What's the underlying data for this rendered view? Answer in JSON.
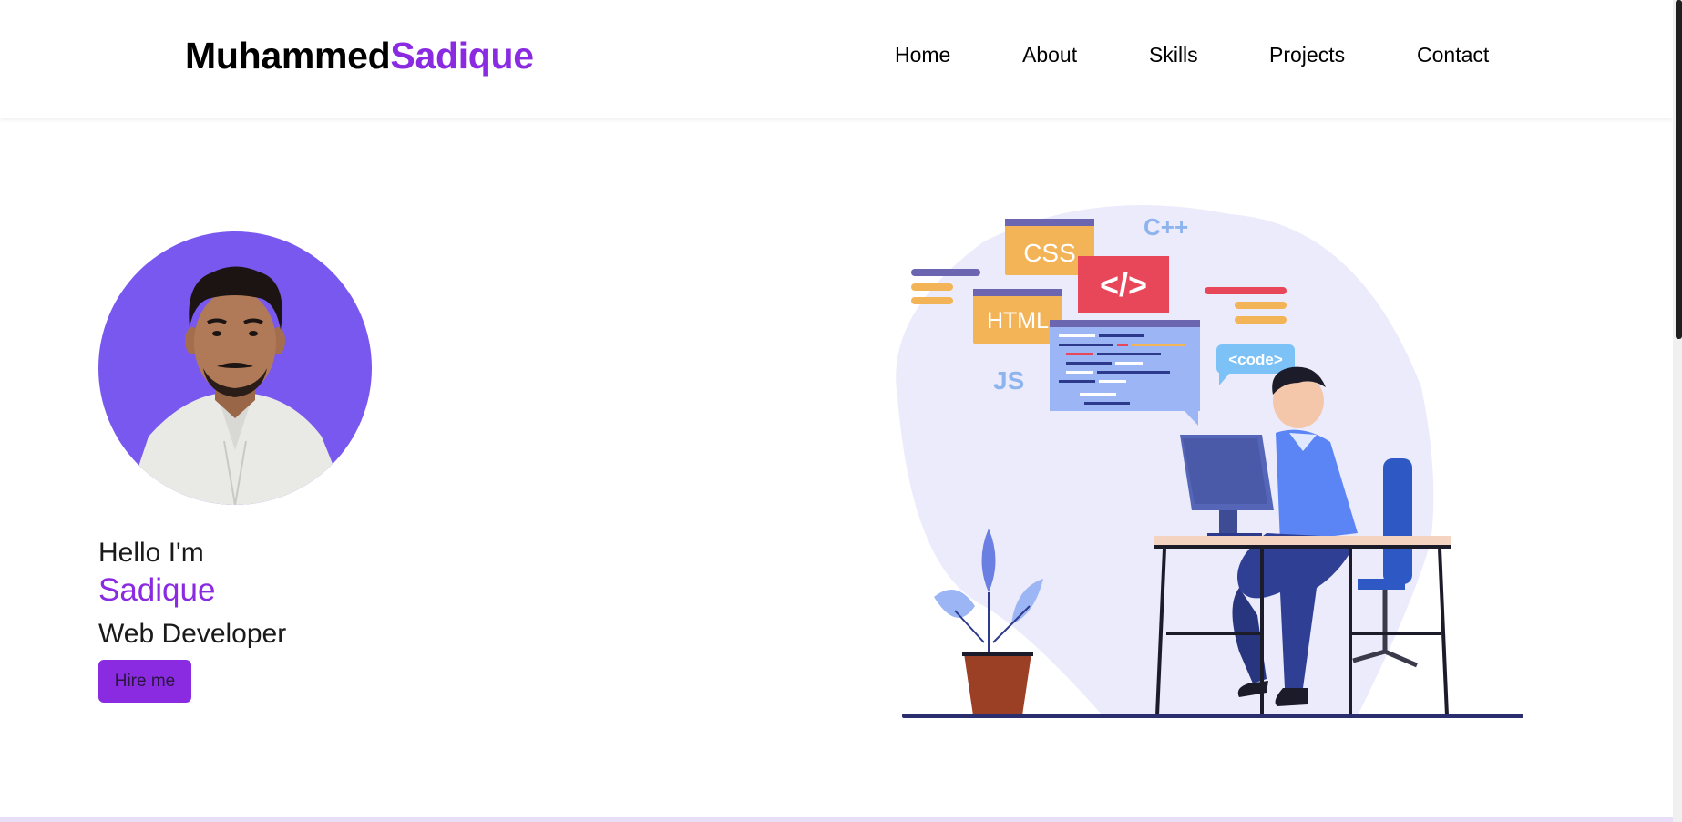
{
  "brand": {
    "first": "Muhammed",
    "last": "Sadique"
  },
  "nav": {
    "items": [
      {
        "label": "Home"
      },
      {
        "label": "About"
      },
      {
        "label": "Skills"
      },
      {
        "label": "Projects"
      },
      {
        "label": "Contact"
      }
    ]
  },
  "hero": {
    "greeting": "Hello I'm",
    "name": "Sadique",
    "role": "Web Developer",
    "cta_label": "Hire me"
  },
  "illustration": {
    "tags": {
      "css": "CSS",
      "html": "HTML",
      "cpp": "C++",
      "js": "JS",
      "code_tag": "</>",
      "code_bubble": "<code>"
    }
  },
  "colors": {
    "accent": "#8a2be2",
    "avatar_bg": "#7858ee",
    "blob": "#ecebfb"
  }
}
